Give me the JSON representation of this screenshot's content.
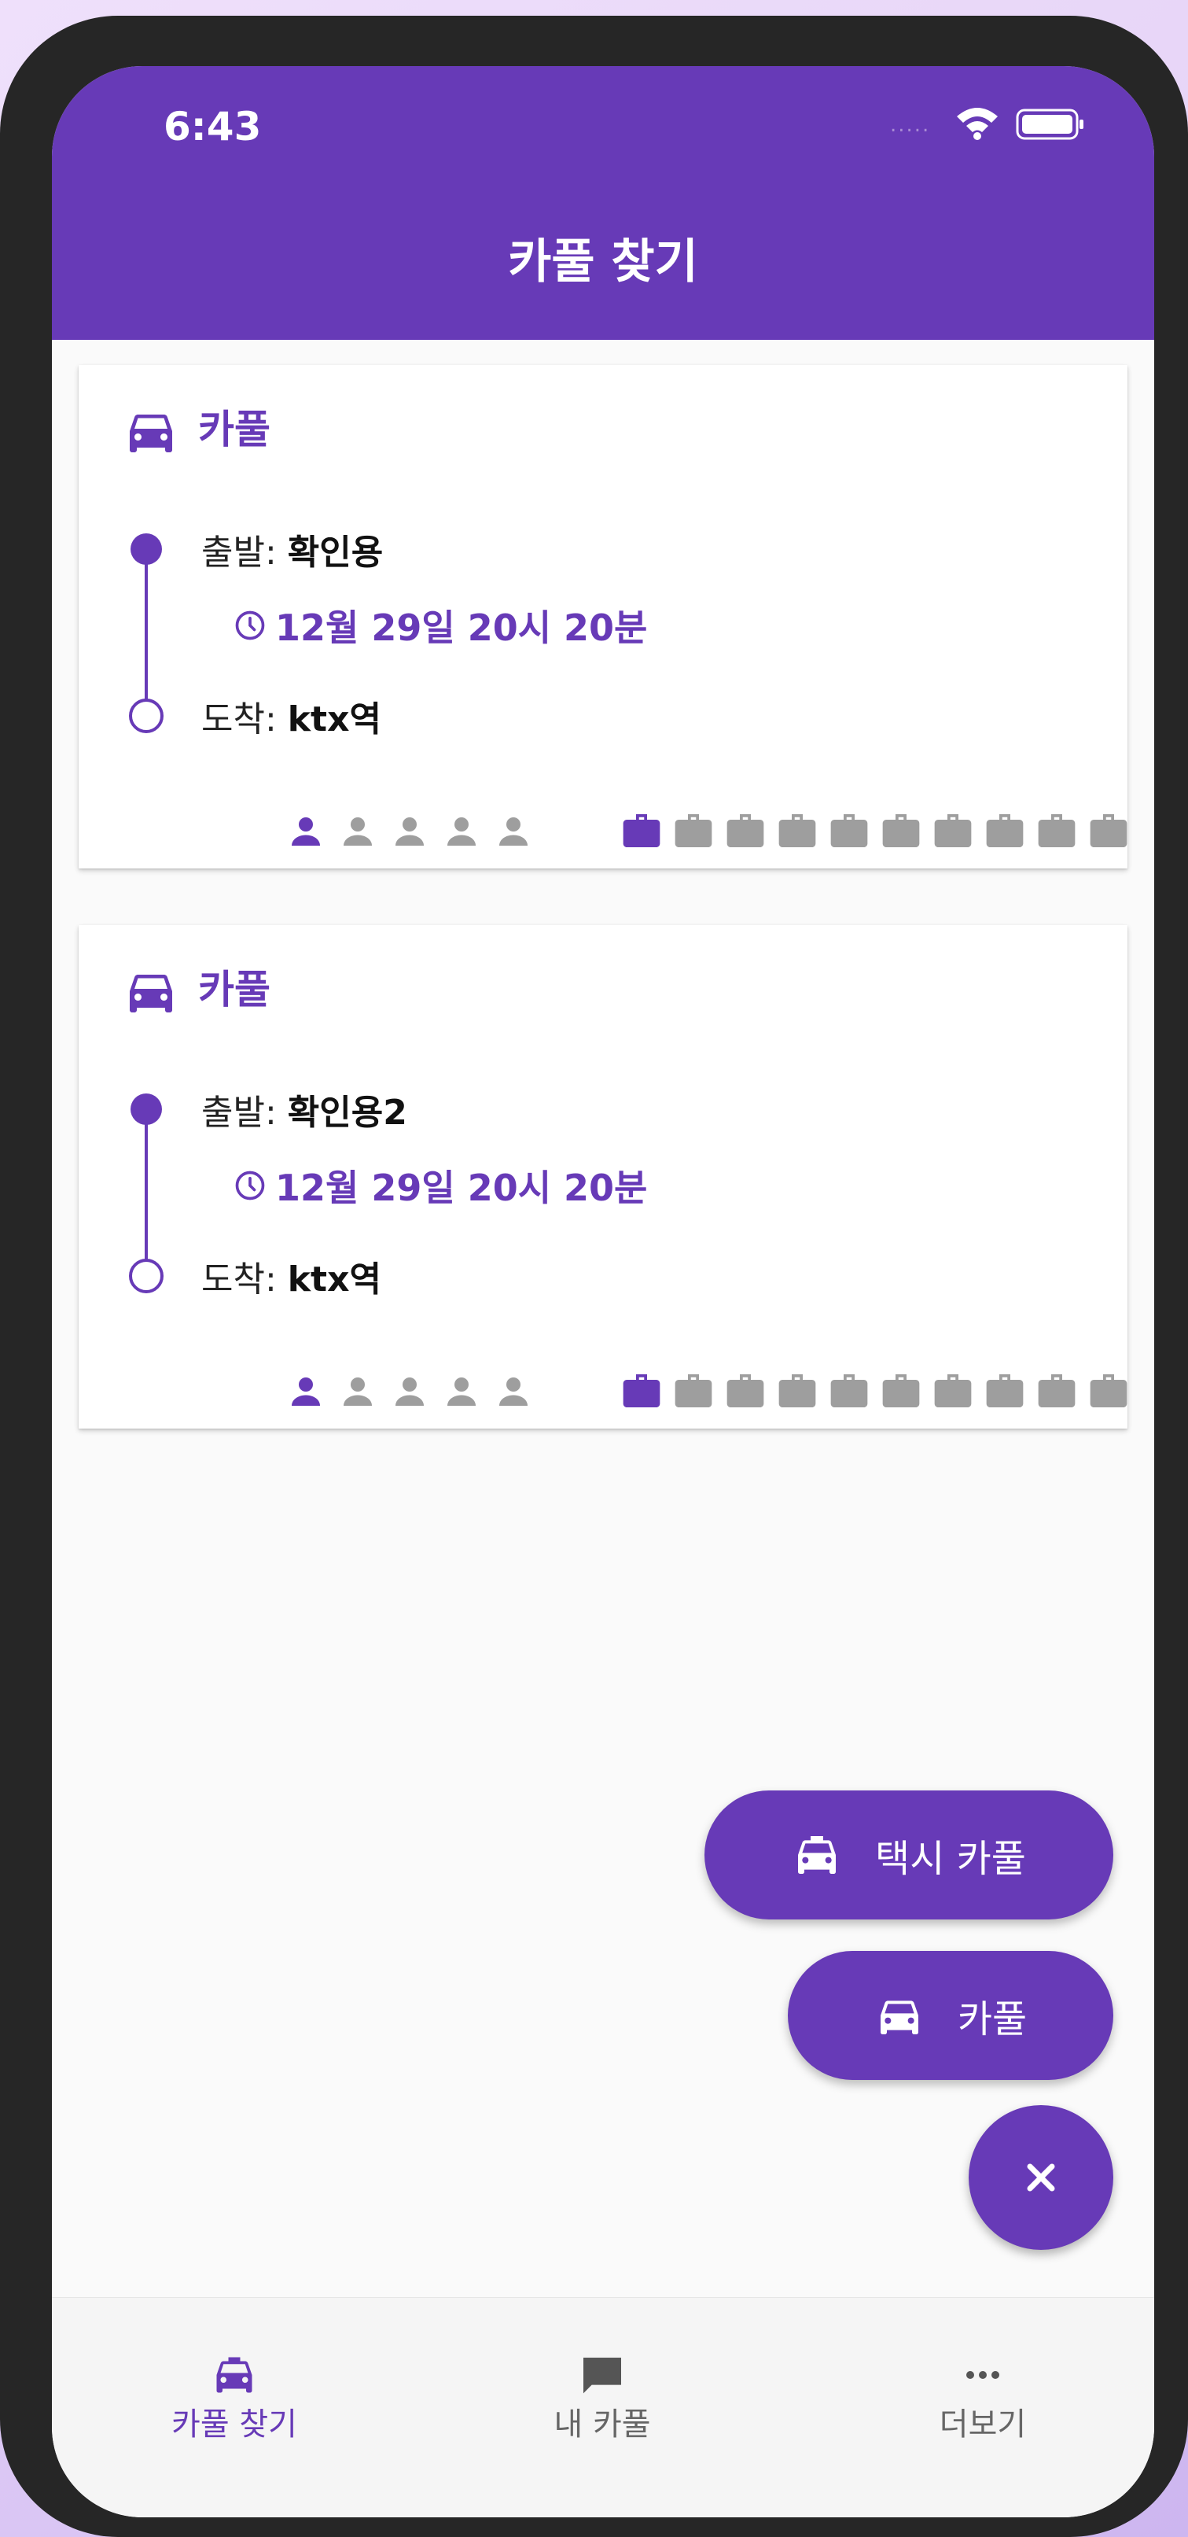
{
  "status_bar": {
    "time": "6:43",
    "signal": "....."
  },
  "app_bar": {
    "title": "카풀 찾기"
  },
  "rides": [
    {
      "type": "카풀",
      "departure_label": "출발: ",
      "departure": "확인용",
      "time": "12월 29일 20시 20분",
      "arrival_label": "도착: ",
      "arrival": "ktx역",
      "passengers_filled": 1,
      "passengers_total": 5,
      "luggage_filled": 1,
      "luggage_total": 10
    },
    {
      "type": "카풀",
      "departure_label": "출발: ",
      "departure": "확인용2",
      "time": "12월 29일 20시 20분",
      "arrival_label": "도착: ",
      "arrival": "ktx역",
      "passengers_filled": 1,
      "passengers_total": 5,
      "luggage_filled": 1,
      "luggage_total": 10
    }
  ],
  "fab": {
    "taxi_label": "택시 카풀",
    "carpool_label": "카풀",
    "close_icon": "close-icon"
  },
  "bottom_nav": {
    "items": [
      {
        "label": "카풀 찾기",
        "icon": "taxi-icon",
        "active": true
      },
      {
        "label": "내 카풀",
        "icon": "chat-icon",
        "active": false
      },
      {
        "label": "더보기",
        "icon": "more-icon",
        "active": false
      }
    ]
  },
  "colors": {
    "primary": "#673ab7",
    "inactive": "#9e9e9e",
    "background": "#fafafa"
  }
}
